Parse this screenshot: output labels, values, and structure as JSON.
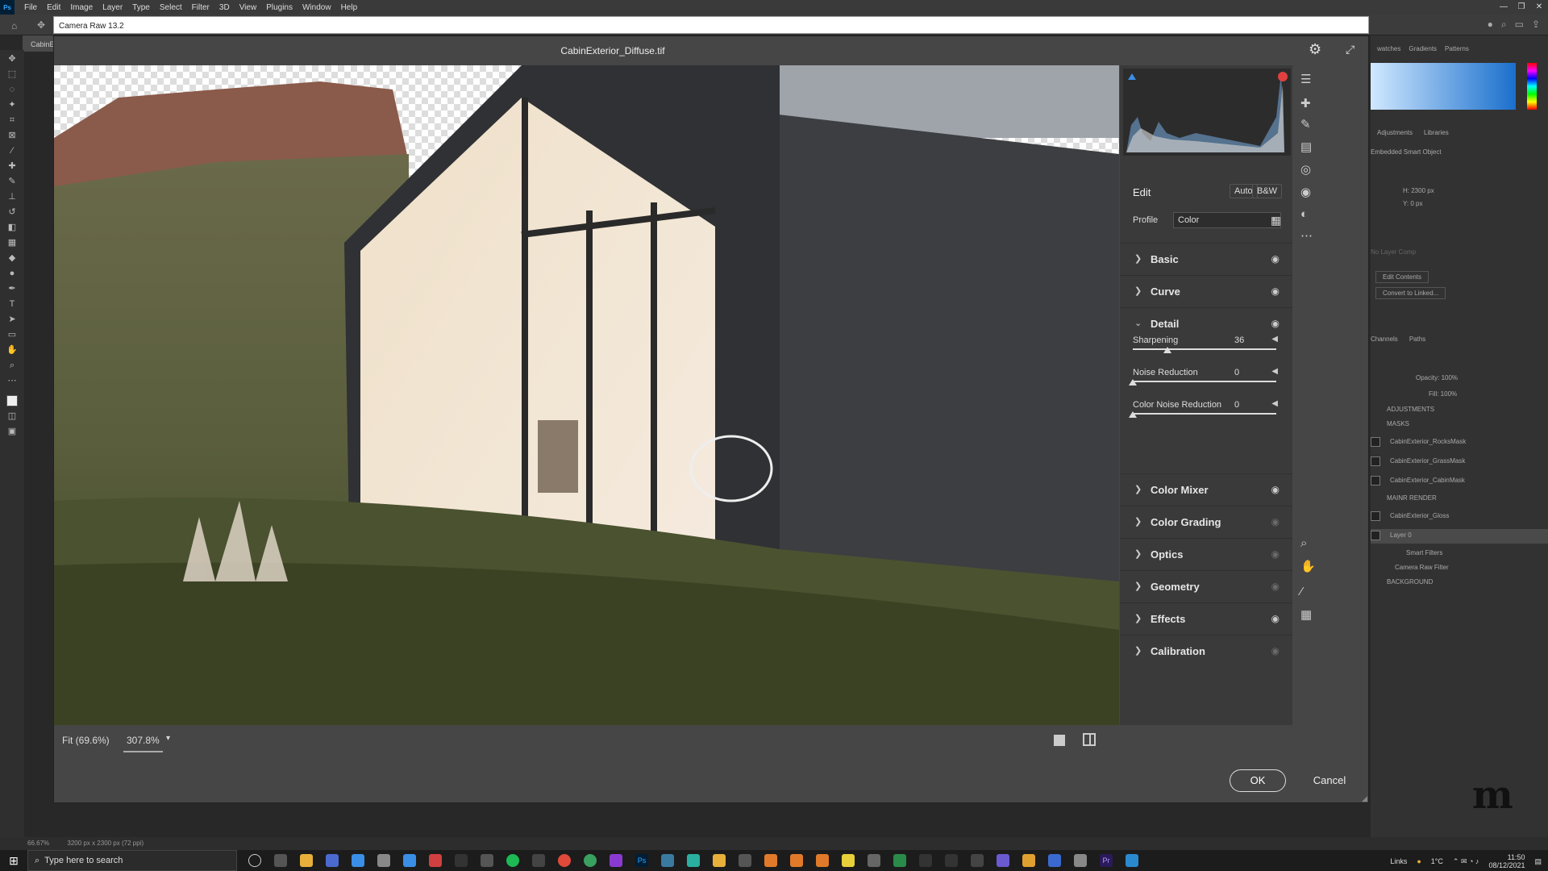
{
  "menubar": {
    "items": [
      "File",
      "Edit",
      "Image",
      "Layer",
      "Type",
      "Select",
      "Filter",
      "3D",
      "View",
      "Plugins",
      "Window",
      "Help"
    ]
  },
  "options_bar": {
    "camera_raw_label": "Camera Raw 13.2"
  },
  "doc_tab": {
    "label": "CabinE"
  },
  "dialog": {
    "title": "CabinExterior_Diffuse.tif",
    "fit_label": "Fit (69.6%)",
    "zoom_label": "307.8%",
    "ok_label": "OK",
    "cancel_label": "Cancel"
  },
  "edit_panel": {
    "title": "Edit",
    "auto_label": "Auto",
    "bw_label": "B&W",
    "profile_label": "Profile",
    "profile_value": "Color",
    "sections": [
      {
        "name": "Basic",
        "eye_active": true
      },
      {
        "name": "Curve",
        "eye_active": true
      },
      {
        "name": "Detail",
        "eye_active": true,
        "expanded": true
      },
      {
        "name": "Color Mixer",
        "eye_active": true
      },
      {
        "name": "Color Grading",
        "eye_active": false
      },
      {
        "name": "Optics",
        "eye_active": false
      },
      {
        "name": "Geometry",
        "eye_active": false
      },
      {
        "name": "Effects",
        "eye_active": true
      },
      {
        "name": "Calibration",
        "eye_active": false
      }
    ],
    "detail_sliders": [
      {
        "label": "Sharpening",
        "value": "36",
        "fraction": 0.24
      },
      {
        "label": "Noise Reduction",
        "value": "0",
        "fraction": 0.0
      },
      {
        "label": "Color Noise Reduction",
        "value": "0",
        "fraction": 0.0
      }
    ]
  },
  "right_panels": {
    "color_tabs": [
      "watches",
      "Gradients",
      "Patterns"
    ],
    "prop_tabs": [
      "Adjustments",
      "Libraries"
    ],
    "embedded_label": "Embedded Smart Object",
    "w_label": "H: 2300 px",
    "y_label": "Y: 0 px",
    "layer_comp": "No Layer Comp",
    "edit_contents": "Edit Contents",
    "convert_linked": "Convert to Linked...",
    "layer_tabs": [
      "Channels",
      "Paths"
    ],
    "opacity": "Opacity: 100%",
    "fill": "Fill: 100%",
    "layers": [
      {
        "name": "ADJUSTMENTS",
        "group": true
      },
      {
        "name": "MASKS",
        "group": true
      },
      {
        "name": "CabinExterior_RocksMask",
        "group": false
      },
      {
        "name": "CabinExterior_GrassMask",
        "group": false
      },
      {
        "name": "CabinExterior_CabinMask",
        "group": false
      },
      {
        "name": "MAINR RENDER",
        "group": true
      },
      {
        "name": "CabinExterior_Gloss",
        "group": false
      },
      {
        "name": "Layer 0",
        "group": false,
        "selected": true
      },
      {
        "name": "Smart Filters",
        "group": false
      },
      {
        "name": "Camera Raw Filter",
        "group": false
      },
      {
        "name": "BACKGROUND",
        "group": true
      }
    ]
  },
  "ps_status": {
    "zoom": "66.67%",
    "doc": "3200 px x 2300 px (72 ppi)"
  },
  "taskbar": {
    "search_placeholder": "Type here to search",
    "links_label": "Links",
    "temp": "1°C",
    "time": "11:50",
    "date": "08/12/2021"
  },
  "colors": {
    "accent_blue": "#3a8ee6",
    "clip_red": "#e04040",
    "ps_blue": "#31a8ff"
  }
}
